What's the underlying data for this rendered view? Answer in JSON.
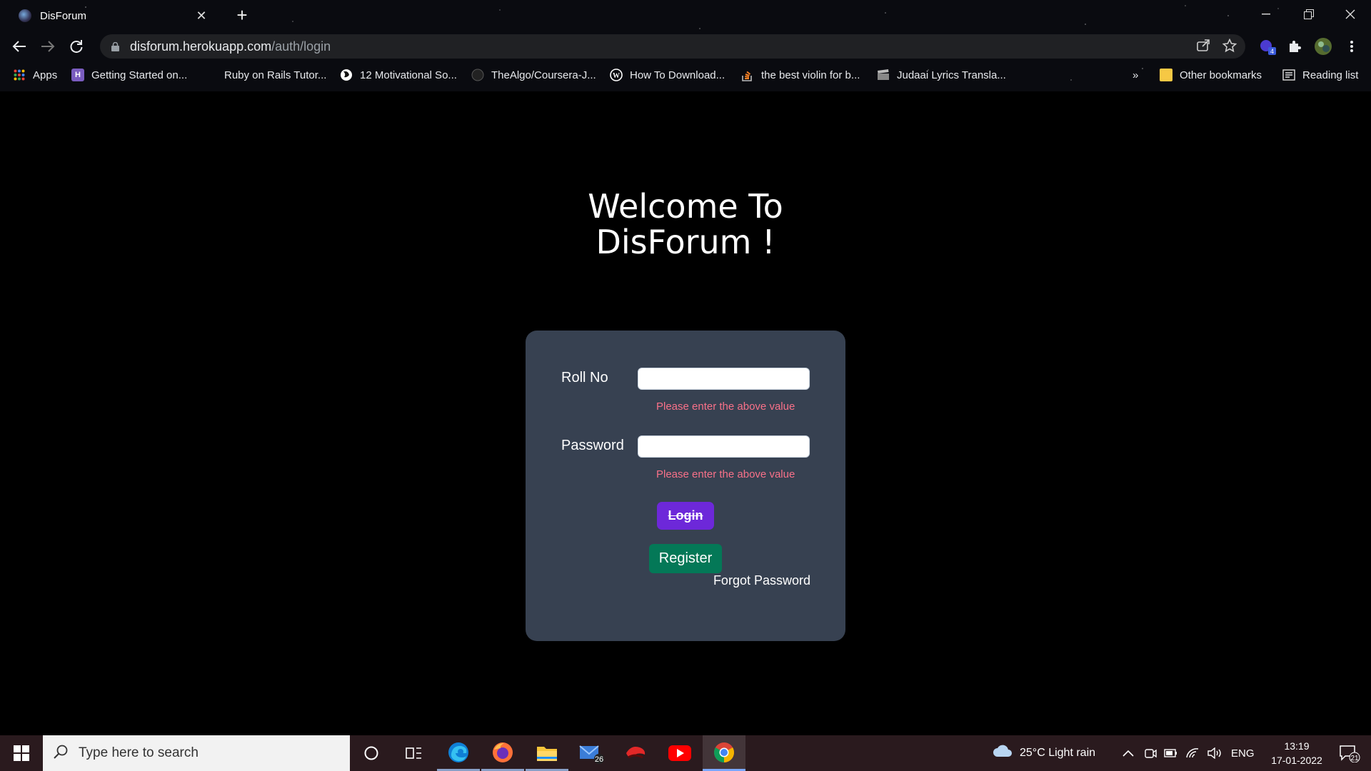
{
  "browser": {
    "tab_title": "DisForum",
    "tab_close": "✕",
    "new_tab": "+",
    "url_host": "disforum.herokuapp.com",
    "url_path": "/auth/login",
    "profile_badge": "4",
    "bookmarks": [
      {
        "label": "Apps",
        "icon": "apps-grid-icon",
        "color": "#ea4335"
      },
      {
        "label": "Getting Started on...",
        "icon": "heroku-icon",
        "color": "#7a5cbf"
      },
      {
        "label": "Ruby on Rails Tutor...",
        "icon": "rails-icon",
        "color": "#000000"
      },
      {
        "label": "12 Motivational So...",
        "icon": "globe-icon",
        "color": "#ffffff"
      },
      {
        "label": "TheAlgo/Coursera-J...",
        "icon": "github-icon",
        "color": "#222222"
      },
      {
        "label": "How To Download...",
        "icon": "wordpress-icon",
        "color": "#21759b"
      },
      {
        "label": "the best violin for b...",
        "icon": "stackoverflow-icon",
        "color": "#f48024"
      },
      {
        "label": "Judaai Lyrics Transla...",
        "icon": "clapper-icon",
        "color": "#888888"
      }
    ],
    "overflow": "»",
    "other_bookmarks": "Other bookmarks",
    "reading_list": "Reading list"
  },
  "page": {
    "welcome_line1": "Welcome To",
    "welcome_line2": "DisForum !",
    "roll_label": "Roll No",
    "roll_value": "",
    "roll_error": "Please enter the above value",
    "password_label": "Password",
    "password_value": "",
    "password_error": "Please enter the above value",
    "login_label": "Login",
    "register_label": "Register",
    "forgot_label": "Forgot Password"
  },
  "taskbar": {
    "search_placeholder": "Type here to search",
    "mail_badge": "26",
    "weather": "25°C  Light rain",
    "language": "ENG",
    "time": "13:19",
    "date": "17-01-2022",
    "notifications": "21"
  },
  "colors": {
    "card_bg": "#374151",
    "login_btn": "#6d28d9",
    "register_btn": "#047857",
    "error_text": "#f87189"
  }
}
